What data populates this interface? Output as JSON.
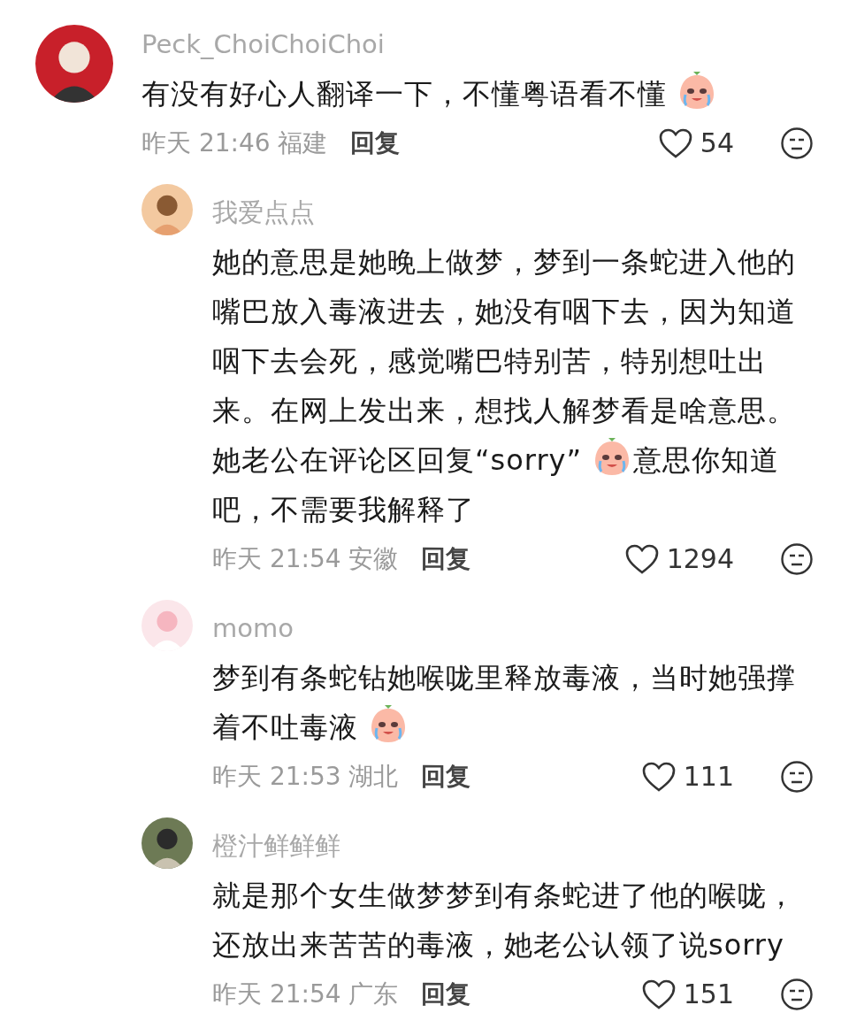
{
  "comments": [
    {
      "user": "Peck_ChoiChoiChoi",
      "lines": [
        [
          {
            "kind": "text",
            "text": "有没有好心人翻译一下，不懂粤语看不懂"
          },
          {
            "kind": "emoji"
          }
        ]
      ],
      "time": "昨天 21:46",
      "location": "福建",
      "reply_label": "回复",
      "likes": "54",
      "replies": [
        {
          "user": "我爱点点",
          "lines": [
            [
              {
                "kind": "text",
                "text": "她的意思是她晚上做梦，梦到一条蛇进入他的"
              }
            ],
            [
              {
                "kind": "text",
                "text": "嘴巴放入毒液进去，她没有咽下去，因为知道"
              }
            ],
            [
              {
                "kind": "text",
                "text": "咽下去会死，感觉嘴巴特别苦，特别想吐出"
              }
            ],
            [
              {
                "kind": "text",
                "text": "来。在网上发出来，想找人解梦看是啥意思。"
              }
            ],
            [
              {
                "kind": "text",
                "text": "她老公在评论区回复“sorry”"
              },
              {
                "kind": "emoji"
              },
              {
                "kind": "text",
                "text": "意思你知道"
              }
            ],
            [
              {
                "kind": "text",
                "text": "吧，不需要我解释了"
              }
            ]
          ],
          "time": "昨天 21:54",
          "location": "安徽",
          "reply_label": "回复",
          "likes": "1294"
        },
        {
          "user": "momo",
          "lines": [
            [
              {
                "kind": "text",
                "text": "梦到有条蛇钻她喉咙里释放毒液，当时她强撑"
              }
            ],
            [
              {
                "kind": "text",
                "text": "着不吐毒液"
              },
              {
                "kind": "emoji"
              }
            ]
          ],
          "time": "昨天 21:53",
          "location": "湖北",
          "reply_label": "回复",
          "likes": "111"
        },
        {
          "user": "橙汁鲜鲜鲜",
          "lines": [
            [
              {
                "kind": "text",
                "text": "就是那个女生做梦梦到有条蛇进了他的喉咙，"
              }
            ],
            [
              {
                "kind": "text",
                "text": "还放出来苦苦的毒液，她老公认领了说sorry"
              }
            ]
          ],
          "time": "昨天 21:54",
          "location": "广东",
          "reply_label": "回复",
          "likes": "151"
        }
      ]
    }
  ]
}
